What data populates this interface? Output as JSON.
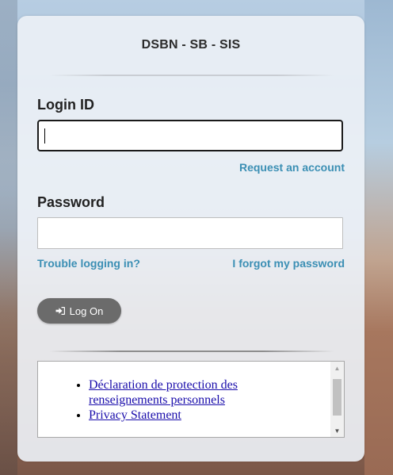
{
  "header": {
    "site_title": "DSBN - SB - SIS"
  },
  "login_form": {
    "login_id_label": "Login ID",
    "login_id_value": "",
    "request_account_link": "Request an account",
    "password_label": "Password",
    "password_value": "",
    "trouble_link": "Trouble logging in?",
    "forgot_link": "I forgot my password",
    "logon_button": {
      "label": "Log On",
      "icon": "sign-in-icon"
    }
  },
  "info_links": [
    {
      "label": "Déclaration de protection des renseignements personnels"
    },
    {
      "label": "Privacy Statement"
    }
  ],
  "colors": {
    "link": "#3b8fb4",
    "button": "#6b6b6b",
    "card": "#ecf0f5"
  }
}
